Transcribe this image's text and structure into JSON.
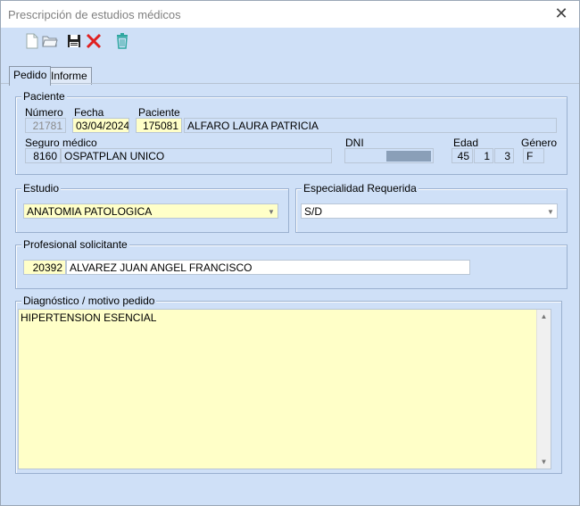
{
  "window": {
    "title": "Prescripción de estudios médicos",
    "close_label": "✕"
  },
  "toolbar": [
    {
      "name": "new-document-icon",
      "glyph": "🗋"
    },
    {
      "name": "open-folder-icon",
      "glyph": "🗁"
    },
    {
      "name": "save-icon",
      "glyph": "💾"
    },
    {
      "name": "delete-x-icon",
      "glyph": "✕"
    },
    {
      "name": "trash-icon",
      "glyph": "🗑"
    }
  ],
  "tabs": {
    "pedido": "Pedido",
    "informe": "Informe"
  },
  "paciente": {
    "group_label": "Paciente",
    "numero_label": "Número",
    "numero": "21781",
    "fecha_label": "Fecha",
    "fecha": "03/04/2024",
    "paciente_label": "Paciente",
    "paciente_id": "175081",
    "paciente_nombre": "ALFARO LAURA PATRICIA",
    "seguro_label": "Seguro médico",
    "seguro_codigo": "8160",
    "seguro_nombre": "OSPATPLAN UNICO",
    "dni_label": "DNI",
    "edad_label": "Edad",
    "edad_anios": "45",
    "edad_meses": "1",
    "edad_dias": "3",
    "genero_label": "Género",
    "genero": "F"
  },
  "estudio": {
    "group_label": "Estudio",
    "value": "ANATOMIA PATOLOGICA"
  },
  "especialidad": {
    "group_label": "Especialidad Requerida",
    "value": "S/D"
  },
  "profesional": {
    "group_label": "Profesional solicitante",
    "codigo": "20392",
    "nombre": "ALVAREZ JUAN ANGEL FRANCISCO"
  },
  "diagnostico": {
    "group_label": "Diagnóstico / motivo pedido",
    "value": "HIPERTENSION ESENCIAL"
  }
}
